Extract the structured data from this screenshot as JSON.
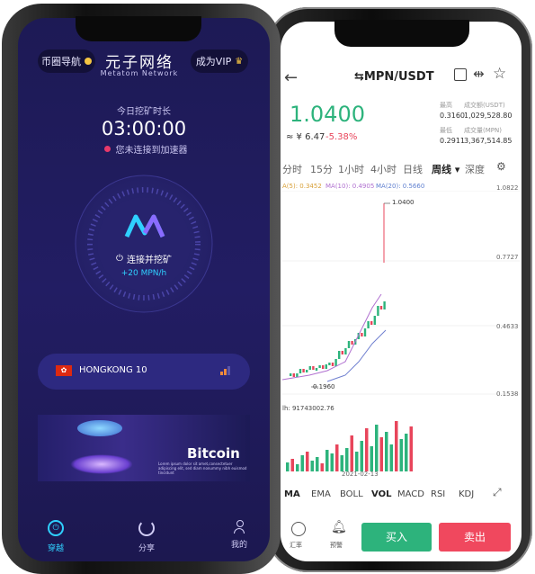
{
  "vpn_app": {
    "nav_button": "币圈导航",
    "vip_button": "成为VIP",
    "app_name": "元子网络",
    "app_subtitle": "Metatom Network",
    "mining_label": "今日挖矿时长",
    "mining_time": "03:00:00",
    "status_text": "您未连接到加速器",
    "connect_label": "连接并挖矿",
    "rate": "+20 MPN/h",
    "server_name": "HONGKONG 10",
    "banner_title": "Bitcoin",
    "banner_text": "Lorem ipsum dolor sit amet,consectetuer adipiscing elit, sed diam nonummy nibh euismod tincidunt",
    "tabs": [
      {
        "label": "穿越",
        "icon": "power-icon"
      },
      {
        "label": "分享",
        "icon": "share-icon"
      },
      {
        "label": "我的",
        "icon": "user-icon"
      }
    ],
    "colors": {
      "accent": "#2fd0ff",
      "background": "#1f1b5d",
      "status_dot": "#e8396a"
    }
  },
  "exchange_app": {
    "pair": "⇆MPN/USDT",
    "price": "1.0400",
    "price_cny": "≈ ¥ 6.47",
    "change": "-5.38%",
    "stats": [
      {
        "label": "最高",
        "value": "0.3160",
        "label2": "成交额(USDT)",
        "value2": "1,029,528.80"
      },
      {
        "label": "最低",
        "value": "0.2911",
        "label2": "成交量(MPN)",
        "value2": "3,367,514.85"
      }
    ],
    "timeframes": [
      "分时",
      "15分",
      "1小时",
      "4小时",
      "日线",
      "周线 ▾",
      "深度"
    ],
    "ma_labels": [
      "A(5): 0.3452",
      "MA(10): 0.4905",
      "MA(20): 0.5660"
    ],
    "price_axis": [
      "1.0822",
      "0.7727",
      "0.4633",
      "0.1538"
    ],
    "high_marker": "1.0400",
    "low_marker": "0.1960",
    "volume_label": "lh: 91743002.76",
    "date_label": "2021-02-13",
    "indicators": [
      "MA",
      "EMA",
      "BOLL",
      "VOL",
      "MACD",
      "RSI",
      "KDJ"
    ],
    "footer": {
      "exchange": "汇率",
      "alert": "预警",
      "buy": "买入",
      "sell": "卖出"
    },
    "colors": {
      "up": "#2db37c",
      "down": "#e8455b",
      "buy": "#2db37c",
      "sell": "#f0485e"
    }
  }
}
